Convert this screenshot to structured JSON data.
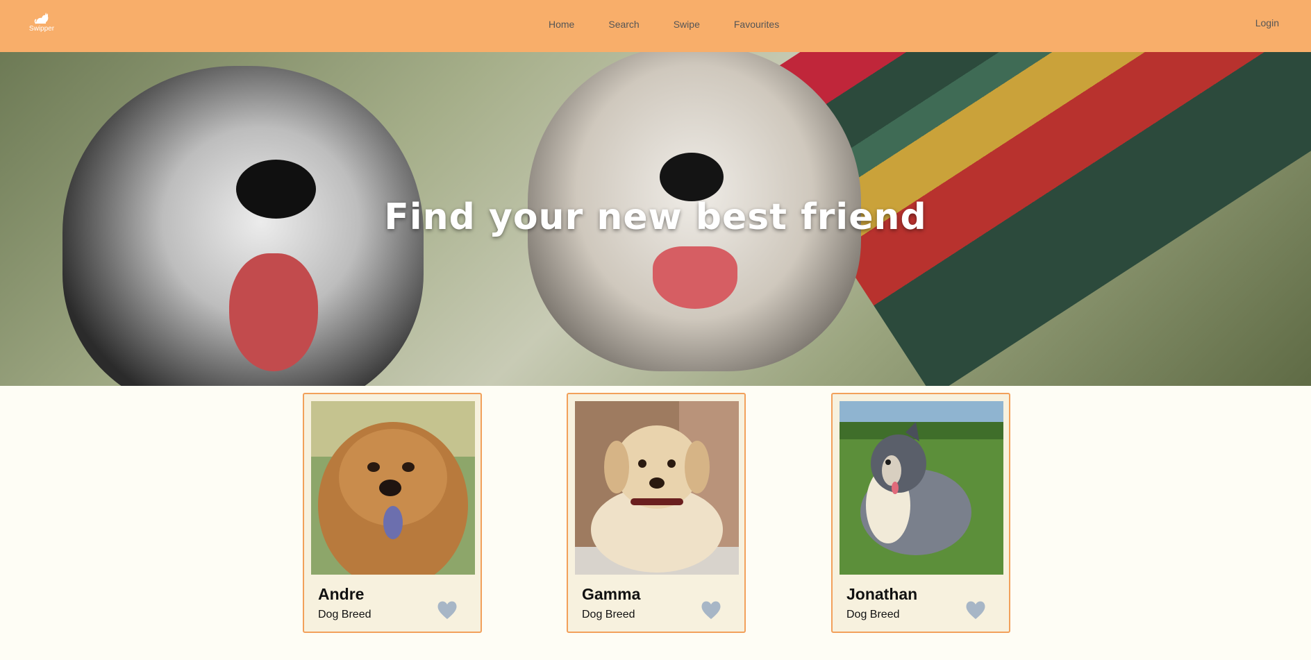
{
  "app": {
    "logo_text": "Swipper"
  },
  "nav": {
    "items": [
      {
        "label": "Home"
      },
      {
        "label": "Search"
      },
      {
        "label": "Swipe"
      },
      {
        "label": "Favourites"
      }
    ],
    "login_label": "Login"
  },
  "hero": {
    "title": "Find your new best friend"
  },
  "cards": [
    {
      "name": "Andre",
      "breed": "Dog Breed"
    },
    {
      "name": "Gamma",
      "breed": "Dog Breed"
    },
    {
      "name": "Jonathan",
      "breed": "Dog Breed"
    }
  ],
  "colors": {
    "navbar": "#f8ae6a",
    "page_background": "#fefdf5",
    "card_border": "#f2a05a",
    "card_background": "#f7f1de",
    "heart": "#a7b6c6"
  },
  "icons": {
    "logo": "cat-icon",
    "favourite": "heart-icon"
  }
}
